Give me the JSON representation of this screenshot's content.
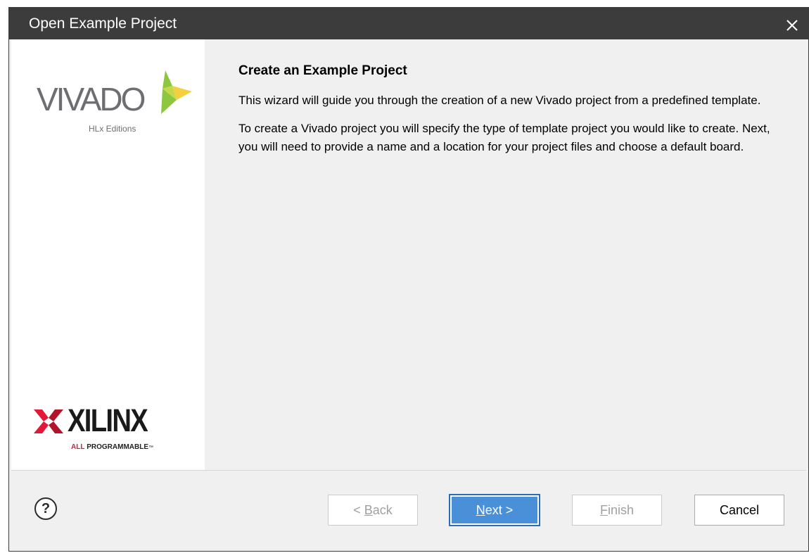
{
  "window": {
    "title": "Open Example Project"
  },
  "branding": {
    "product_name": "VIVADO",
    "edition": "HLx Editions",
    "company": "XILINX",
    "tagline_all": "ALL",
    "tagline_programmable": "PROGRAMMABLE"
  },
  "content": {
    "heading": "Create an Example Project",
    "paragraph1": "This wizard will guide you through the creation of a new Vivado project from a predefined template.",
    "paragraph2": "To create a Vivado project you will specify the type of template project you would like to create. Next, you will need to provide a name and a location for your project files and choose a default board."
  },
  "buttons": {
    "help": "?",
    "back": {
      "prefix": "< ",
      "mnemonic": "B",
      "rest": "ack",
      "enabled": false
    },
    "next": {
      "mnemonic": "N",
      "rest": "ext >",
      "enabled": true
    },
    "finish": {
      "mnemonic": "F",
      "rest": "inish",
      "enabled": false
    },
    "cancel": {
      "label": "Cancel",
      "enabled": true
    }
  },
  "icons": {
    "close": "close-icon",
    "help": "help-icon",
    "vivado_mark": "vivado-mark-icon",
    "xilinx_mark": "xilinx-mark-icon"
  },
  "colors": {
    "titlebar": "#3c3c3c",
    "primary_button": "#4a90d9",
    "vivado_green": "#8dc63f",
    "vivado_yellow": "#f4d03f",
    "xilinx_red": "#e31837"
  }
}
